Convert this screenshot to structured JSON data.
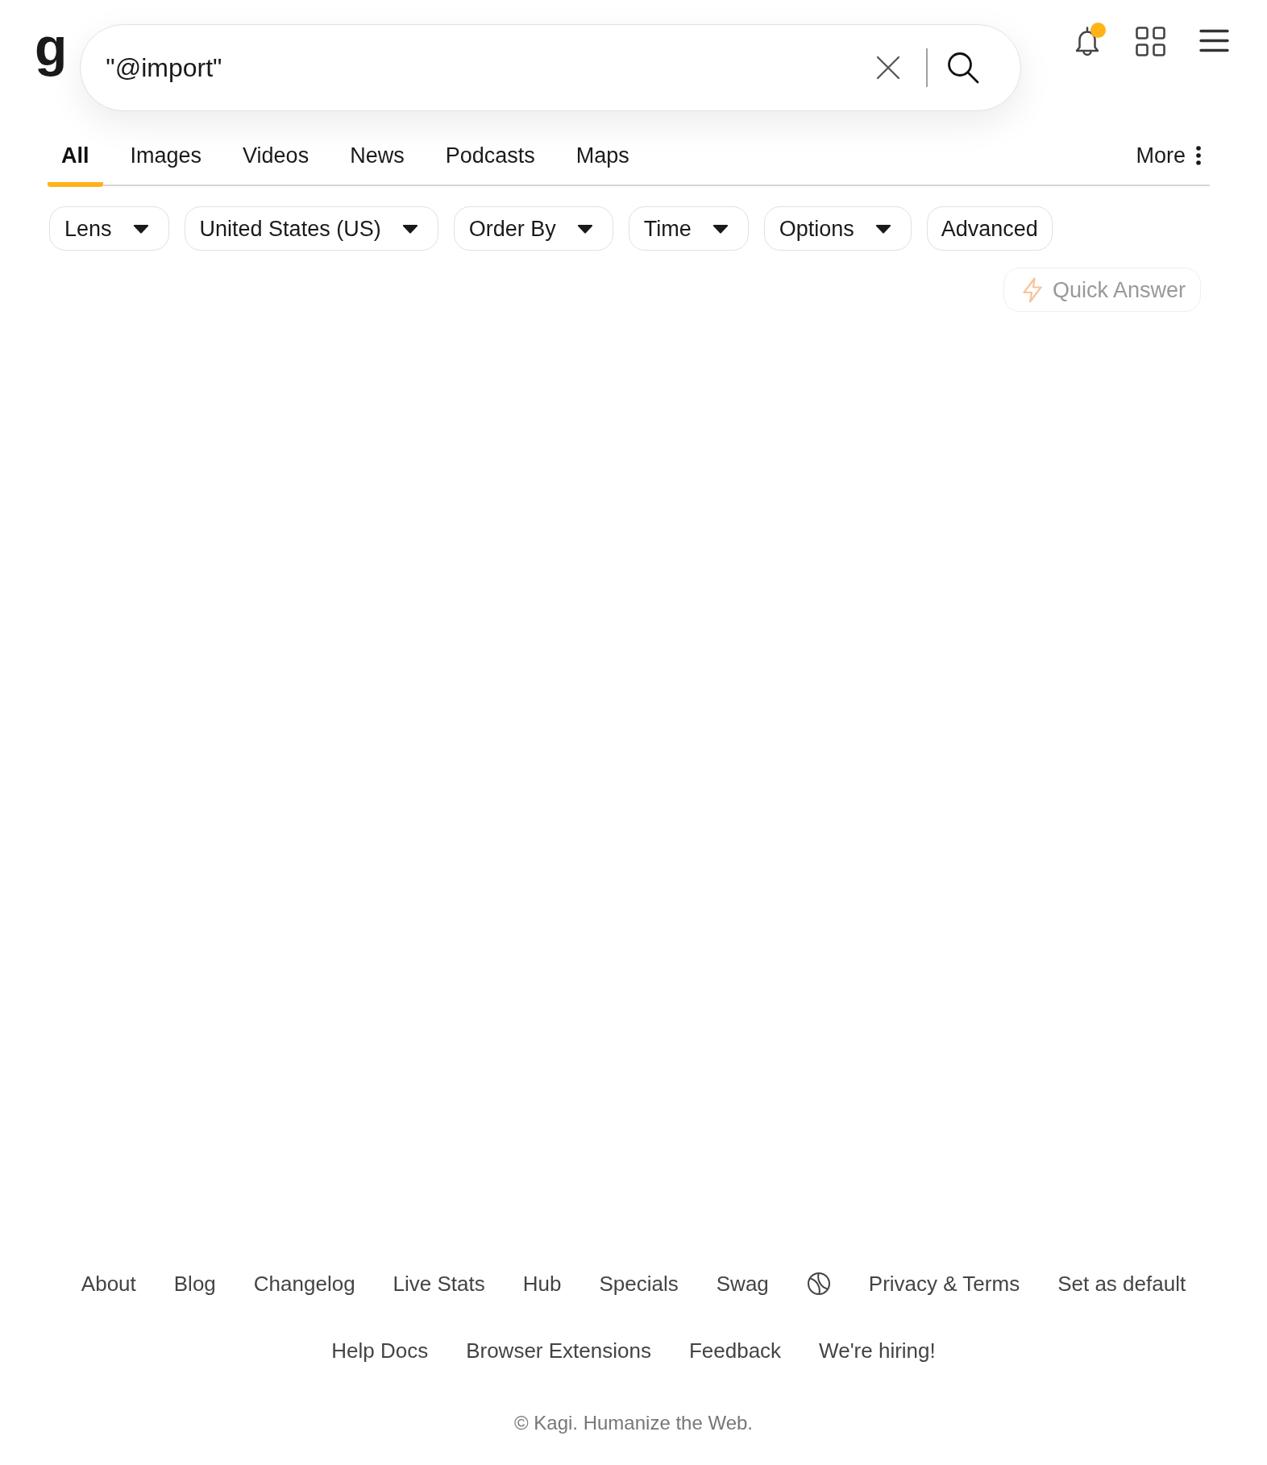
{
  "header": {
    "logo": "g",
    "search": {
      "value": "\"@import\""
    },
    "notifications": {
      "unread": true
    }
  },
  "tabs": [
    {
      "label": "All",
      "selected": true
    },
    {
      "label": "Images",
      "selected": false
    },
    {
      "label": "Videos",
      "selected": false
    },
    {
      "label": "News",
      "selected": false
    },
    {
      "label": "Podcasts",
      "selected": false
    },
    {
      "label": "Maps",
      "selected": false
    }
  ],
  "more_menu": {
    "label": "More"
  },
  "filters": [
    {
      "kind": "dropdown",
      "label": "Lens"
    },
    {
      "kind": "dropdown",
      "label": "United States (US)"
    },
    {
      "kind": "dropdown",
      "label": "Order By"
    },
    {
      "kind": "dropdown",
      "label": "Time"
    },
    {
      "kind": "dropdown",
      "label": "Options"
    },
    {
      "kind": "button",
      "label": "Advanced"
    }
  ],
  "quick_answer": {
    "label": "Quick Answer",
    "disabled": true
  },
  "footer": {
    "links": [
      {
        "kind": "link",
        "label": "About"
      },
      {
        "kind": "link",
        "label": "Blog"
      },
      {
        "kind": "link",
        "label": "Changelog"
      },
      {
        "kind": "link",
        "label": "Live Stats"
      },
      {
        "kind": "link",
        "label": "Hub"
      },
      {
        "kind": "link",
        "label": "Specials"
      },
      {
        "kind": "link",
        "label": "Swag"
      },
      {
        "kind": "icon"
      },
      {
        "kind": "link",
        "label": "Privacy & Terms"
      },
      {
        "kind": "link",
        "label": "Set as default"
      }
    ],
    "secondary_links": [
      {
        "label": "Help Docs"
      },
      {
        "label": "Browser Extensions"
      },
      {
        "label": "Feedback"
      },
      {
        "label": "We're hiring!"
      }
    ],
    "copyright": "© Kagi. Humanize the Web."
  }
}
